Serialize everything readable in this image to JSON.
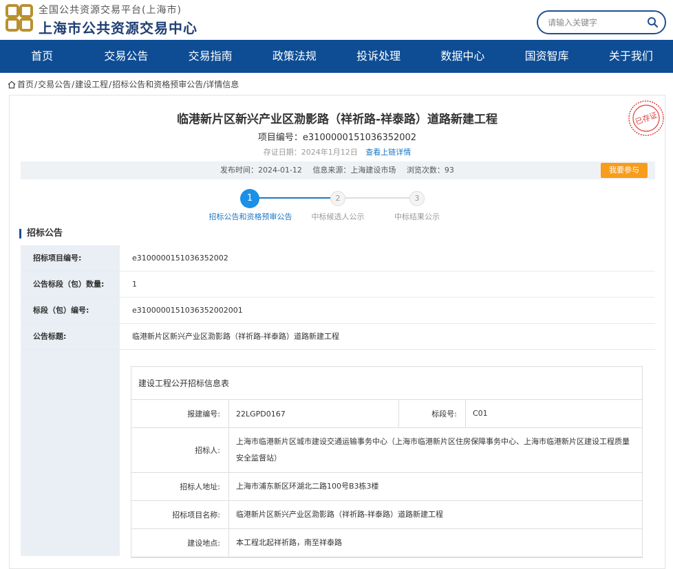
{
  "header": {
    "platform_name": "全国公共资源交易平台(上海市)",
    "site_name": "上海市公共资源交易中心",
    "search_placeholder": "请输入关键字"
  },
  "nav": {
    "items": [
      "首页",
      "交易公告",
      "交易指南",
      "政策法规",
      "投诉处理",
      "数据中心",
      "国资智库",
      "关于我们"
    ]
  },
  "breadcrumb": {
    "items": [
      "首页",
      "交易公告",
      "建设工程",
      "招标公告和资格预审公告"
    ],
    "current": "/详情信息"
  },
  "notice": {
    "title": "临港新片区新兴产业区泐影路（祥祈路-祥泰路）道路新建工程",
    "project_no": "项目编号：e3100000151036352002",
    "evidence_date": "存证日期：2024年1月12日",
    "chain_link": "查看上链详情",
    "stamp_text": "已存证",
    "publish_time": "发布时间：2024-01-12",
    "source": "信息来源：上海建设市场",
    "views": "浏览次数：93",
    "join_button": "我要参与"
  },
  "steps": [
    {
      "number": "1",
      "label": "招标公告和资格预审公告",
      "state": "active"
    },
    {
      "number": "2",
      "label": "中标候选人公示",
      "state": "inactive"
    },
    {
      "number": "3",
      "label": "中标结果公示",
      "state": "inactive"
    }
  ],
  "section_title": "招标公告",
  "details": [
    {
      "label": "招标项目编号:",
      "value": "e3100000151036352002"
    },
    {
      "label": "公告标段（包）数量:",
      "value": "1"
    },
    {
      "label": "标段（包）编号:",
      "value": "e3100000151036352002001"
    },
    {
      "label": "公告标题:",
      "value": "临港新片区新兴产业区泐影路（祥祈路-祥泰路）道路新建工程"
    }
  ],
  "info_table": {
    "caption": "建设工程公开招标信息表",
    "report_no_label": "报建编号:",
    "report_no": "22LGPD0167",
    "section_no_label": "标段号:",
    "section_no": "C01",
    "tenderer_label": "招标人:",
    "tenderer": "上海市临港新片区城市建设交通运输事务中心（上海市临港新片区住房保障事务中心、上海市临港新片区建设工程质量安全监督站）",
    "address_label": "招标人地址:",
    "address": "上海市浦东新区环湖北二路100号B3栋3楼",
    "project_name_label": "招标项目名称:",
    "project_name": "临港新片区新兴产业区泐影路（祥祈路-祥泰路）道路新建工程",
    "location_label": "建设地点:",
    "location": "本工程北起祥祈路，南至祥泰路"
  },
  "colors": {
    "nav_bg": "#0e4d94",
    "brand_text": "#1e3f73",
    "accent_blue": "#1a90e6",
    "join_orange": "#f89c1c",
    "stamp_red": "#e03c3c"
  }
}
